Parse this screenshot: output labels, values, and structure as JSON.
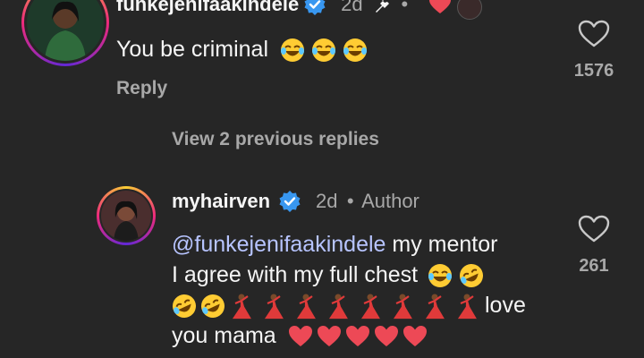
{
  "comment1": {
    "username": "funkejenifaakindele",
    "time": "2d",
    "text": "You be criminal",
    "emojis": [
      "laughing-tears",
      "laughing-tears",
      "laughing-tears"
    ],
    "reply_label": "Reply",
    "likes": "1576"
  },
  "view_replies": "View 2 previous replies",
  "comment2": {
    "username": "myhairven",
    "time": "2d",
    "role": "Author",
    "mention": "@funkejenifaakindele",
    "line1_rest": " my mentor",
    "line2": "I agree with my full chest",
    "line3_text": "love",
    "line4": "you mama",
    "likes": "261"
  },
  "colors": {
    "background": "#262626",
    "mention": "#b7c4ff",
    "verified": "#3897f0",
    "heart": "#ed4956"
  }
}
